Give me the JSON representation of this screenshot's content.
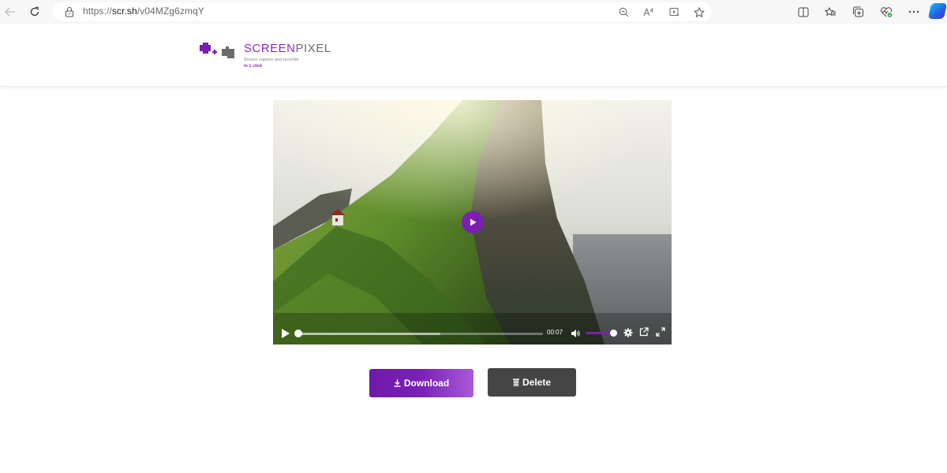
{
  "browser": {
    "url_prefix": "https://",
    "url_domain": "scr.sh",
    "url_path": "/v04MZg6zmqY",
    "icons": {
      "back": "arrow-left-icon",
      "reload": "reload-icon",
      "lock": "lock-icon",
      "address_bar": [
        "zoom-out-icon",
        "read-aloud-icon",
        "immersive-reader-icon",
        "favorite-star-icon"
      ],
      "toolbar": [
        "split-screen-icon",
        "favorites-icon",
        "collections-icon",
        "browser-essentials-icon",
        "more-icon",
        "copilot-icon"
      ]
    }
  },
  "header": {
    "logo_title_part1": "SCREEN",
    "logo_title_part2": "PIXEL",
    "logo_tagline": "Screen capture and recorder",
    "logo_tagline2": "in 1 click",
    "brand_color": "#8a2bc4"
  },
  "video": {
    "current_time": "00:07",
    "progress_fraction": 0.0,
    "buffered_fraction": 0.58,
    "volume_fraction": 1.0,
    "accent_color": "#7a1fb0",
    "icons": [
      "play-icon",
      "volume-icon",
      "settings-icon",
      "popout-icon",
      "fullscreen-icon"
    ]
  },
  "actions": {
    "download_label": "Download",
    "delete_label": "Delete",
    "download_color": "#7a21b6",
    "delete_color": "#454545"
  }
}
